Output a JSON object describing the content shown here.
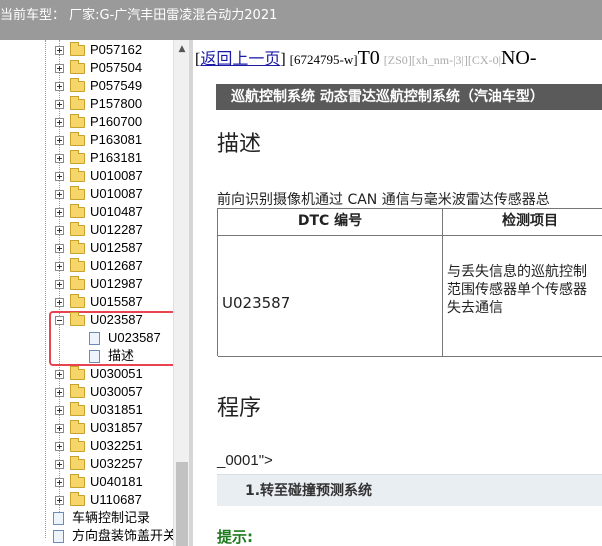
{
  "window": {
    "title": "当前车型：  厂家:G-广汽丰田雷凌混合动力2021"
  },
  "tree": {
    "folders": [
      "P057162",
      "P057504",
      "P057549",
      "P157800",
      "P160700",
      "P163081",
      "P163181",
      "U010087",
      "U010087",
      "U010487",
      "U012287",
      "U012587",
      "U012687",
      "U012987",
      "U015587",
      "U023587",
      "U030051",
      "U030057",
      "U031851",
      "U031857",
      "U032251",
      "U032257",
      "U040181",
      "U110687"
    ],
    "expanded_folder": "U023587",
    "expanded_children": [
      "U023587",
      "描述"
    ],
    "bottom_items": [
      "车辆控制记录",
      "方向盘装饰盖开关"
    ],
    "highlight_color": "#e8444f"
  },
  "content": {
    "back_link": "返回上一页",
    "doc_id": "[6724795-w]",
    "t0": "T0",
    "grey_codes": "[ZS0][xh_nm-|3|][CX-0|",
    "no_code": "NO-",
    "banner": "巡航控制系统  动态雷达巡航控制系统（汽油车型）",
    "section_desc": "描述",
    "paragraph": "前向识别摄像机通过 CAN 通信与毫米波雷达传感器总",
    "table": {
      "headers": [
        "DTC 编号",
        "检测项目"
      ],
      "rows": [
        {
          "code": "U023587",
          "desc_lines": [
            "与丢失信息的巡航控制",
            "范围传感器单个传感器",
            "失去通信"
          ]
        }
      ]
    },
    "section_proc": "程序",
    "anchor_text": "_0001\">",
    "step": "1.转至碰撞预测系统",
    "hint": "提示:"
  },
  "colors": {
    "titlebar": "#9a9a9a",
    "banner": "#5a5a5a",
    "link": "#1a1aa6",
    "hint": "#1e7a1e"
  }
}
